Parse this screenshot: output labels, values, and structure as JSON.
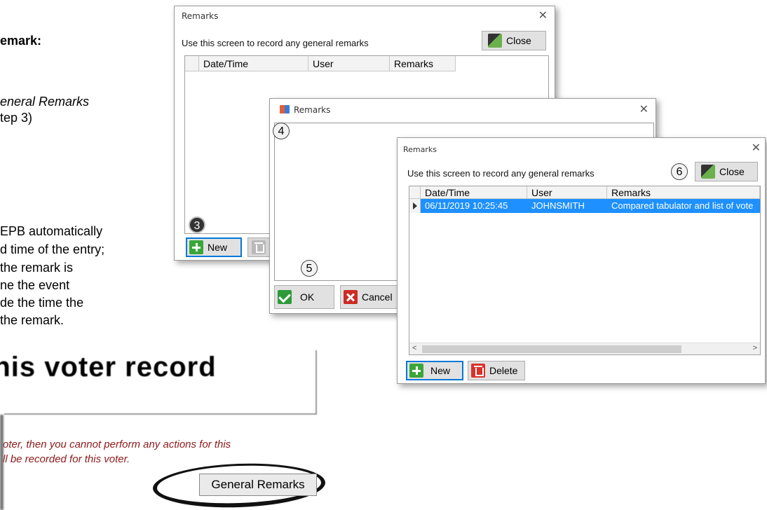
{
  "doc": {
    "heading": "emark:",
    "italic_line": "eneral Remarks",
    "step_ref": "tep 3)",
    "body_lines": [
      "EPB automatically",
      "d time of the entry;",
      "the remark is",
      "ne the event",
      "de the time the",
      "the remark."
    ]
  },
  "voter_panel": {
    "header": "this voter record",
    "notice_line1": "oter, then you cannot perform any actions for this",
    "notice_line2": "ll be recorded for this voter.",
    "button_label": "General Remarks"
  },
  "window_back": {
    "title": "Remarks",
    "close_glyph": "✕",
    "instructions": "Use this screen to record any general remarks",
    "close_label": "Close",
    "columns": [
      "Date/Time",
      "User",
      "Remarks"
    ],
    "new_label": "New",
    "step_badge": "3"
  },
  "window_mid": {
    "title": "Remarks",
    "close_glyph": "✕",
    "ok_label": "OK",
    "cancel_label": "Cancel",
    "step_badge_top": "4",
    "step_badge_bottom": "5"
  },
  "window_front": {
    "title": "Remarks",
    "close_glyph": "✕",
    "instructions": "Use this screen to record any general remarks",
    "close_label": "Close",
    "step_badge": "6",
    "columns": [
      "Date/Time",
      "User",
      "Remarks"
    ],
    "rows": [
      {
        "datetime": "06/11/2019 10:25:45",
        "user": "JOHNSMITH",
        "remarks": "Compared tabulator and list of vote"
      }
    ],
    "new_label": "New",
    "delete_label": "Delete",
    "scroll_left": "<",
    "scroll_right": ">"
  },
  "colors": {
    "selection": "#1e90ff",
    "notice_text": "#8b1a1a",
    "focus_border": "#0078d7"
  }
}
